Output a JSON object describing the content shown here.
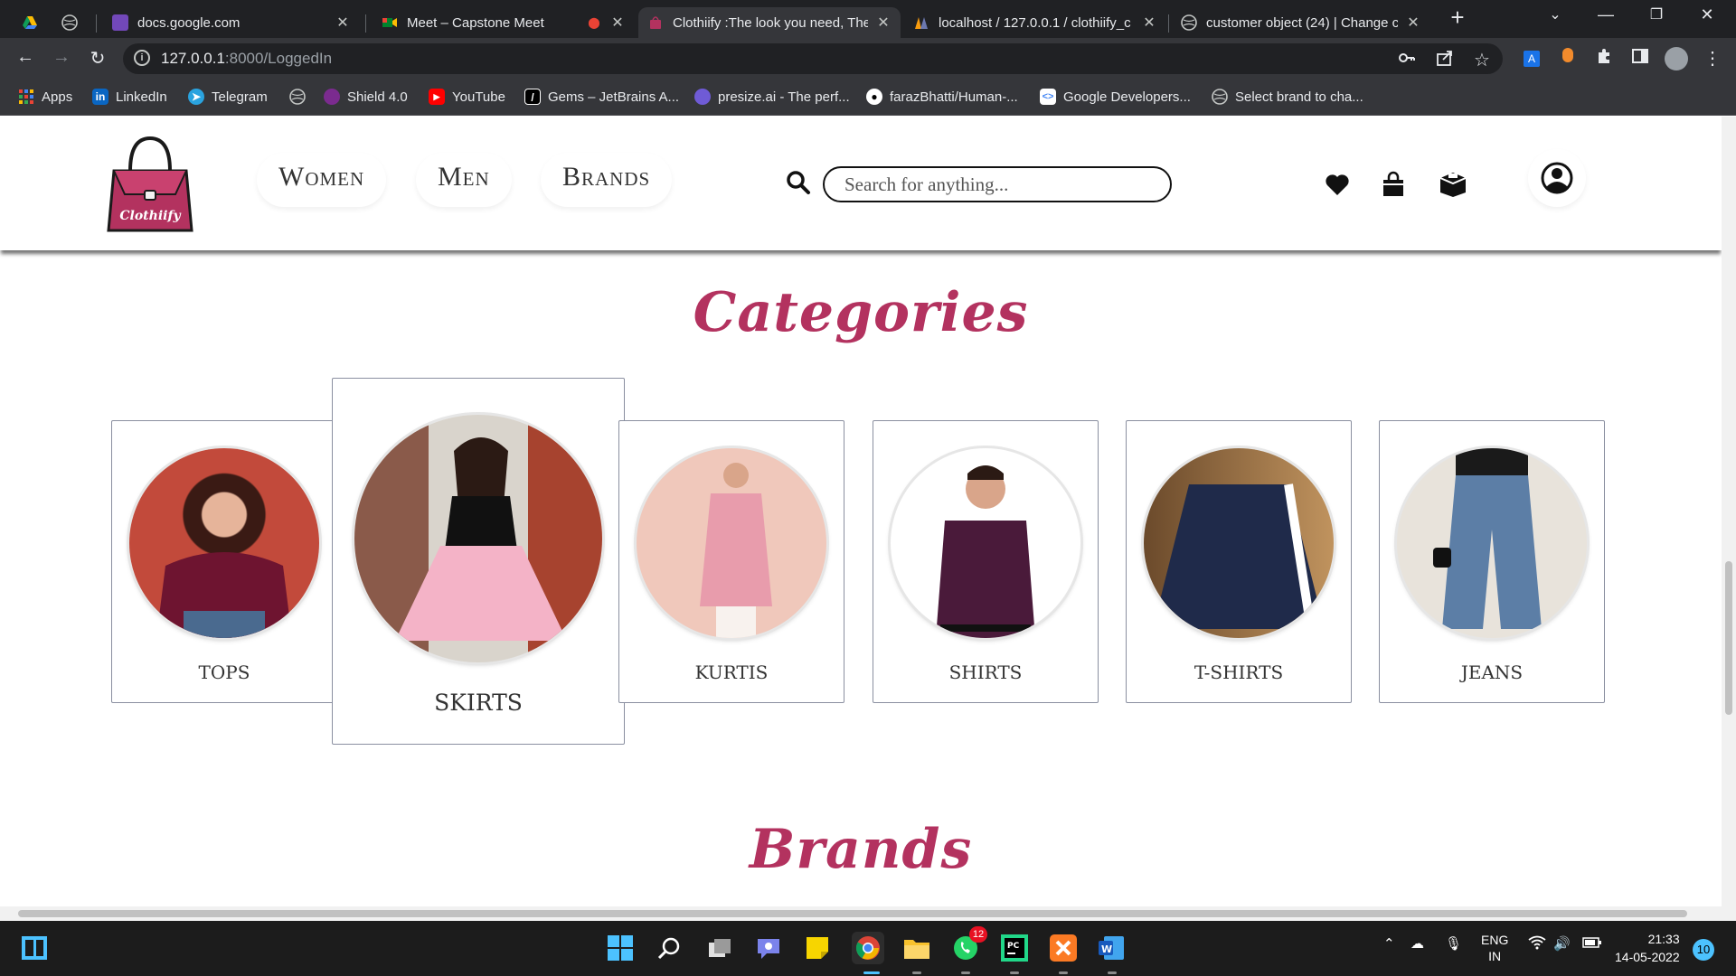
{
  "browser": {
    "tabs": [
      {
        "title": "",
        "favicon": "google-drive-icon"
      },
      {
        "title": "",
        "favicon": "globe-icon"
      },
      {
        "title": "docs.google.com",
        "favicon": "google-forms-icon"
      },
      {
        "title": "Meet – Capstone Meet",
        "favicon": "google-meet-icon"
      },
      {
        "title": "Clothiify :The look you need, The",
        "favicon": "bag-icon"
      },
      {
        "title": "localhost / 127.0.0.1 / clothiify_c",
        "favicon": "phpmyadmin-icon"
      },
      {
        "title": "customer object (24) | Change cu",
        "favicon": "globe-icon"
      }
    ],
    "url_host": "127.0.0.1",
    "url_path": ":8000/LoggedIn",
    "bookmarks": [
      {
        "label": "Apps",
        "icon": "apps-grid-icon"
      },
      {
        "label": "LinkedIn",
        "icon": "linkedin-icon"
      },
      {
        "label": "Telegram",
        "icon": "telegram-icon"
      },
      {
        "label": "",
        "icon": "globe-icon"
      },
      {
        "label": "Shield 4.0",
        "icon": "shield-icon"
      },
      {
        "label": "YouTube",
        "icon": "youtube-icon"
      },
      {
        "label": "Gems – JetBrains A...",
        "icon": "jetbrains-icon"
      },
      {
        "label": "presize.ai - The perf...",
        "icon": "presize-icon"
      },
      {
        "label": "farazBhatti/Human-...",
        "icon": "github-icon"
      },
      {
        "label": "Google Developers...",
        "icon": "google-developers-icon"
      },
      {
        "label": "Select brand to cha...",
        "icon": "globe-icon"
      }
    ]
  },
  "site": {
    "logo_text": "Clothiify",
    "nav": {
      "women": "Women",
      "men": "Men",
      "brands": "Brands"
    },
    "search_placeholder": "Search for anything...",
    "icons": [
      "heart-icon",
      "shopping-bag-icon",
      "box-icon",
      "user-icon"
    ],
    "categories_title": "Categories",
    "categories": [
      {
        "label": "TOPS",
        "color": "#c24a3b"
      },
      {
        "label": "SKIRTS",
        "color": "#f2b8c8"
      },
      {
        "label": "KURTIS",
        "color": "#f0c8bb"
      },
      {
        "label": "SHIRTS",
        "color": "#ffffff"
      },
      {
        "label": "T-SHIRTS",
        "color": "#1f2a4a"
      },
      {
        "label": "JEANS",
        "color": "#c9c4bc"
      }
    ],
    "brands_title": "Brands",
    "accent_color": "#b3325f"
  },
  "taskbar": {
    "lang_top": "ENG",
    "lang_bottom": "IN",
    "time": "21:33",
    "date": "14-05-2022",
    "notifications": "10",
    "whatsapp_badge": "12"
  }
}
